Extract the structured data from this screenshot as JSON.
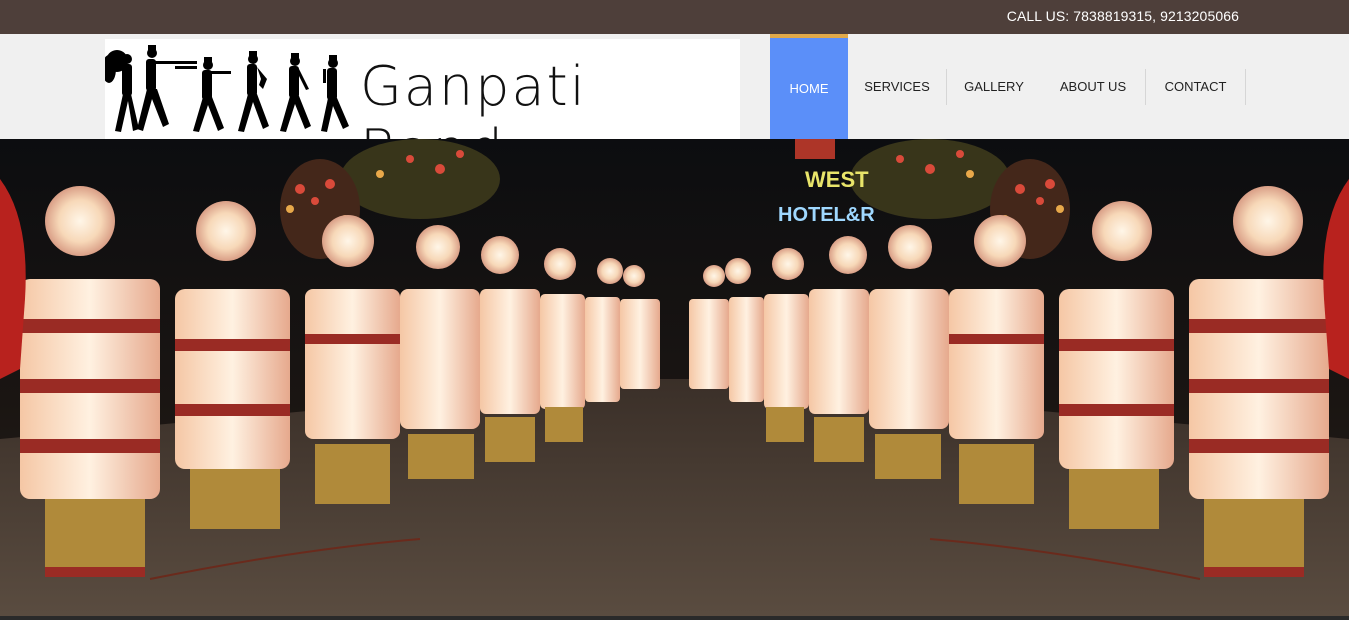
{
  "topbar": {
    "call_text": "CALL US: 7838819315, 9213205066"
  },
  "logo": {
    "brand": "Ganpati Band",
    "icon": "marching-band-silhouettes"
  },
  "nav": {
    "items": [
      {
        "label": "HOME",
        "active": true
      },
      {
        "label": "SERVICES",
        "active": false
      },
      {
        "label": "GALLERY",
        "active": false
      },
      {
        "label": "ABOUT US",
        "active": false
      },
      {
        "label": "CONTACT",
        "active": false
      }
    ]
  },
  "hero": {
    "sign_line1": "WEST",
    "sign_line2": "HOTEL&R"
  },
  "colors": {
    "topbar": "#4e3f3a",
    "nav_active": "#5b8ff9",
    "nav_active_border": "#e0a94a",
    "header_bg": "#f0f0f0"
  }
}
